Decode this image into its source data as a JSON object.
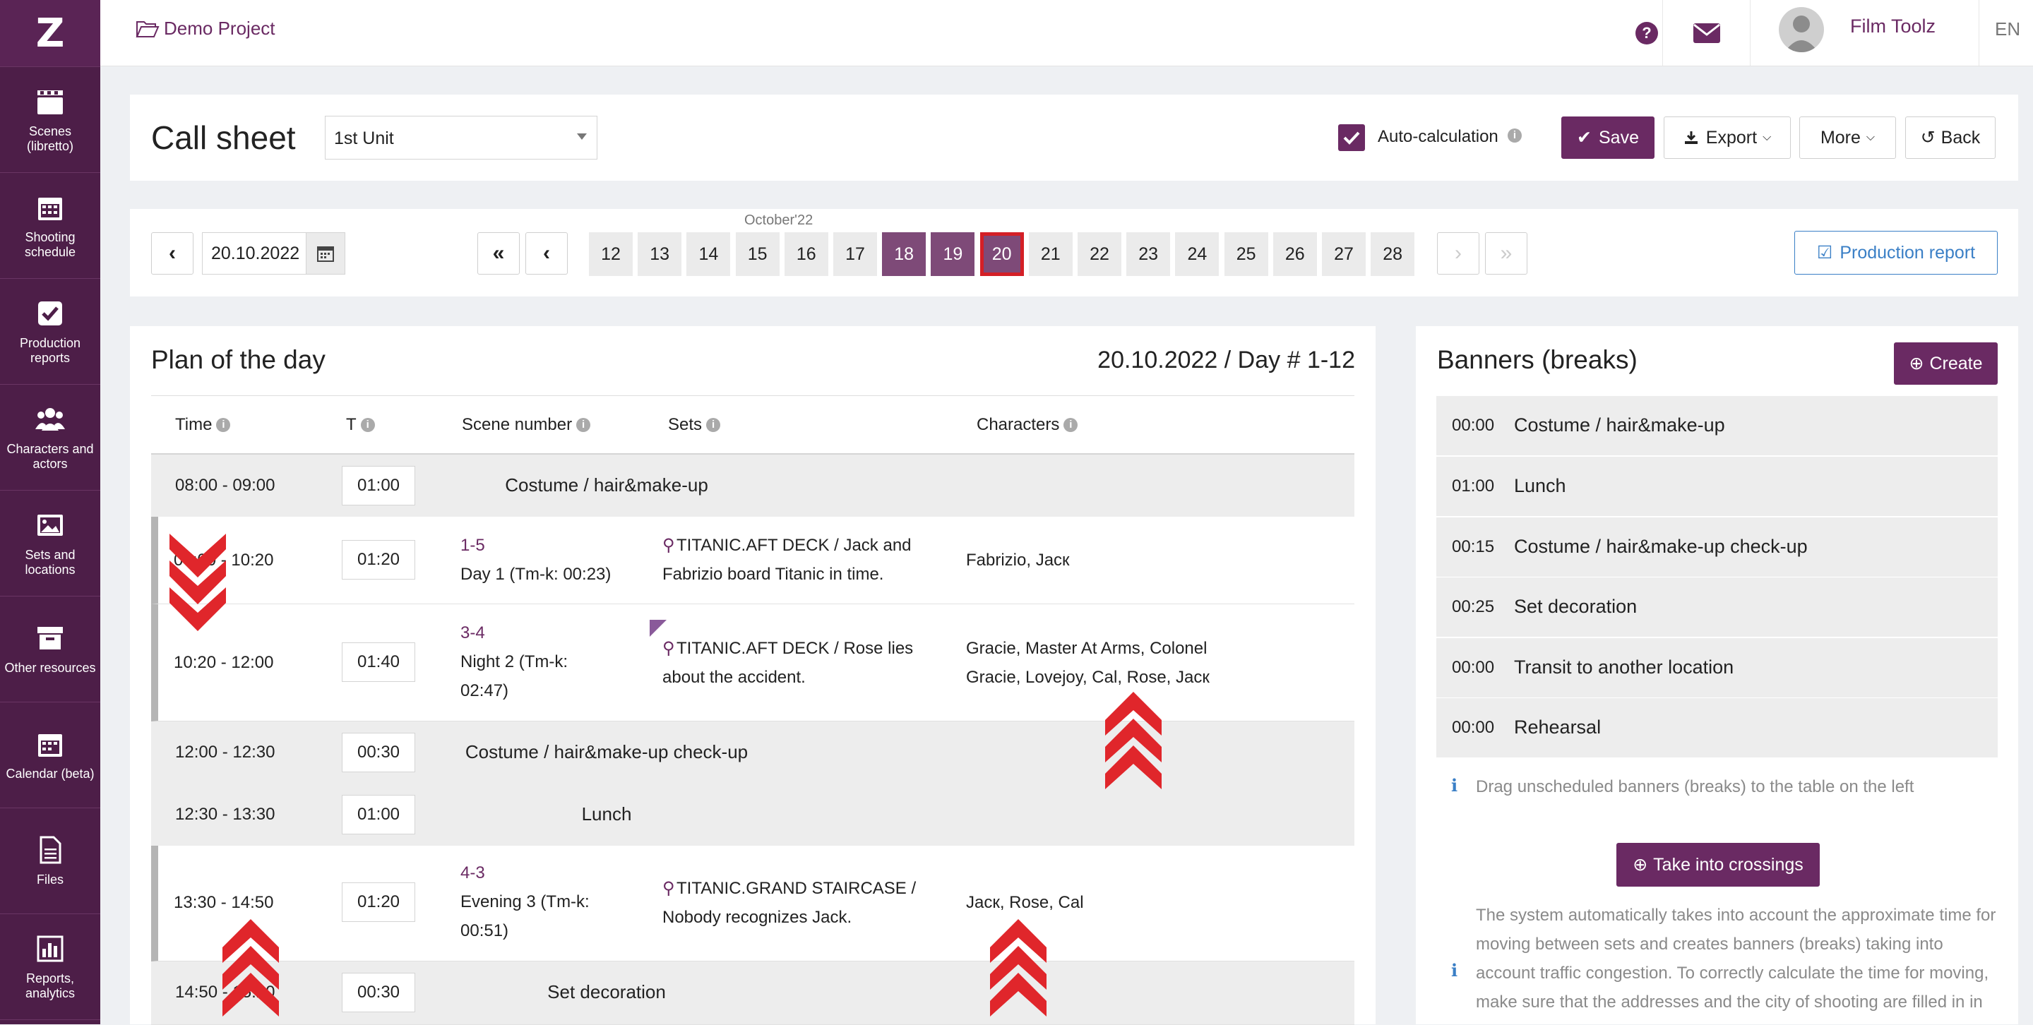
{
  "sidebar": {
    "logo": "Z",
    "items": [
      {
        "label": "Scenes (libretto)"
      },
      {
        "label": "Shooting schedule"
      },
      {
        "label": "Production reports"
      },
      {
        "label": "Characters and actors"
      },
      {
        "label": "Sets and locations"
      },
      {
        "label": "Other resources"
      },
      {
        "label": "Calendar (beta)"
      },
      {
        "label": "Files"
      },
      {
        "label": "Reports, analytics"
      }
    ]
  },
  "topbar": {
    "project": "Demo Project",
    "user_name": "Film Toolz",
    "language": "EN"
  },
  "header": {
    "title": "Call sheet",
    "unit_select": "1st Unit",
    "auto_calc_label": "Auto-calculation",
    "auto_calc_checked": true,
    "save": "Save",
    "export": "Export",
    "more": "More",
    "back": "Back"
  },
  "datebar": {
    "date_value": "20.10.2022",
    "month_label": "October'22",
    "days": [
      "12",
      "13",
      "14",
      "15",
      "16",
      "17",
      "18",
      "19",
      "20",
      "21",
      "22",
      "23",
      "24",
      "25",
      "26",
      "27",
      "28"
    ],
    "selected_days": [
      "18",
      "19"
    ],
    "current_day": "20",
    "production_report": "Production report"
  },
  "plan": {
    "title": "Plan of the day",
    "date_day": "20.10.2022 / Day # 1-12",
    "columns": {
      "time": "Time",
      "t": "T",
      "scene_number": "Scene number",
      "sets": "Sets",
      "characters": "Characters"
    },
    "rows": [
      {
        "type": "banner",
        "time": "08:00 - 09:00",
        "duration": "01:00",
        "name": "Costume / hair&make-up"
      },
      {
        "type": "scene",
        "time": "09:00 - 10:20",
        "duration": "01:20",
        "scene_number": "1-5",
        "scene_desc": "Day 1 (Tm-k: 00:23)",
        "set": "TITANIC.AFT DECK / Jack and Fabrizio board Titanic in time.",
        "characters": "Fabrizio, Jacк"
      },
      {
        "type": "scene",
        "time": "10:20 - 12:00",
        "duration": "01:40",
        "scene_number": "3-4",
        "scene_desc": "Night 2 (Tm-k: 02:47)",
        "set": "TITANIC.AFT DECK / Rose lies about the accident.",
        "characters": "Gracie, Master At Arms, Colonel Gracie, Lovejoy, Cal, Rose, Jacк"
      },
      {
        "type": "banner",
        "time": "12:00 - 12:30",
        "duration": "00:30",
        "name": "Costume / hair&make-up check-up"
      },
      {
        "type": "banner",
        "time": "12:30 - 13:30",
        "duration": "01:00",
        "name": "Lunch"
      },
      {
        "type": "scene",
        "time": "13:30 - 14:50",
        "duration": "01:20",
        "scene_number": "4-3",
        "scene_desc": "Evening 3 (Tm-k: 00:51)",
        "set": "TITANIC.GRAND STAIRCASE / Nobody recognizes Jack.",
        "characters": "Jacк, Rose, Cal"
      },
      {
        "type": "banner",
        "time": "14:50 - 15:20",
        "duration": "00:30",
        "name": "Set decoration"
      }
    ]
  },
  "banners": {
    "title": "Banners (breaks)",
    "create": "Create",
    "items": [
      {
        "time": "00:00",
        "name": "Costume / hair&make-up"
      },
      {
        "time": "01:00",
        "name": "Lunch"
      },
      {
        "time": "00:15",
        "name": "Costume / hair&make-up check-up"
      },
      {
        "time": "00:25",
        "name": "Set decoration"
      },
      {
        "time": "00:00",
        "name": "Transit to another location"
      },
      {
        "time": "00:00",
        "name": "Rehearsal"
      }
    ],
    "drag_hint": "Drag unscheduled banners (breaks) to the table on the left",
    "take_into_crossings": "Take into crossings",
    "auto_note": "The system automatically takes into account the approximate time for moving between sets and creates banners (breaks) taking into account traffic congestion. To correctly calculate the time for moving, make sure that the addresses and the city of shooting are filled in in"
  },
  "colors": {
    "brand": "#6a2a63",
    "sidebar": "#4d1e48",
    "arrow": "#e0262b",
    "link_blue": "#3a7fc6"
  }
}
